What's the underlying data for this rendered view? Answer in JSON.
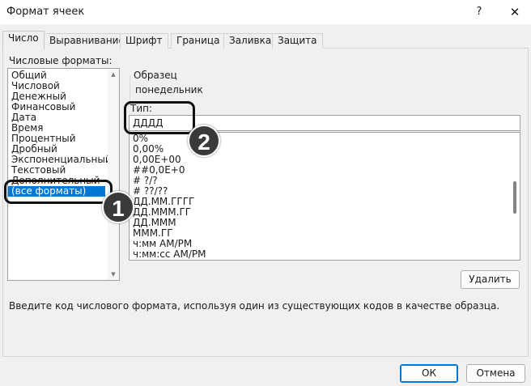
{
  "window": {
    "title": "Формат ячеек",
    "help": "?",
    "close": "✕"
  },
  "tabs": [
    "Число",
    "Выравнивание",
    "Шрифт",
    "Граница",
    "Заливка",
    "Защита"
  ],
  "active_tab": 0,
  "categories_label": "Числовые форматы:",
  "categories": [
    "Общий",
    "Числовой",
    "Денежный",
    "Финансовый",
    "Дата",
    "Время",
    "Процентный",
    "Дробный",
    "Экспоненциальный",
    "Текстовый",
    "Дополнительный",
    "(все форматы)"
  ],
  "selected_category": "(все форматы)",
  "sample": {
    "label": "Образец",
    "value": "понедельник"
  },
  "type": {
    "label": "Тип:",
    "value": "ДДДД"
  },
  "format_codes": [
    "0%",
    "0,00%",
    "0,00E+00",
    "##0,0E+0",
    "# ?/?",
    "# ??/??",
    "ДД.ММ.ГГГГ",
    "ДД.МММ.ГГ",
    "ДД.МММ",
    "МММ.ГГ",
    "ч:мм AM/PM",
    "ч:мм:сс AM/PM"
  ],
  "delete_button": "Удалить",
  "hint": "Введите код числового формата, используя один из существующих кодов в качестве образца.",
  "ok_button": "ОК",
  "cancel_button": "Отмена",
  "annotations": {
    "step1": "1",
    "step2": "2"
  },
  "colors": {
    "selection": "#0078d7",
    "dialog_bg": "#f0f0f0"
  }
}
